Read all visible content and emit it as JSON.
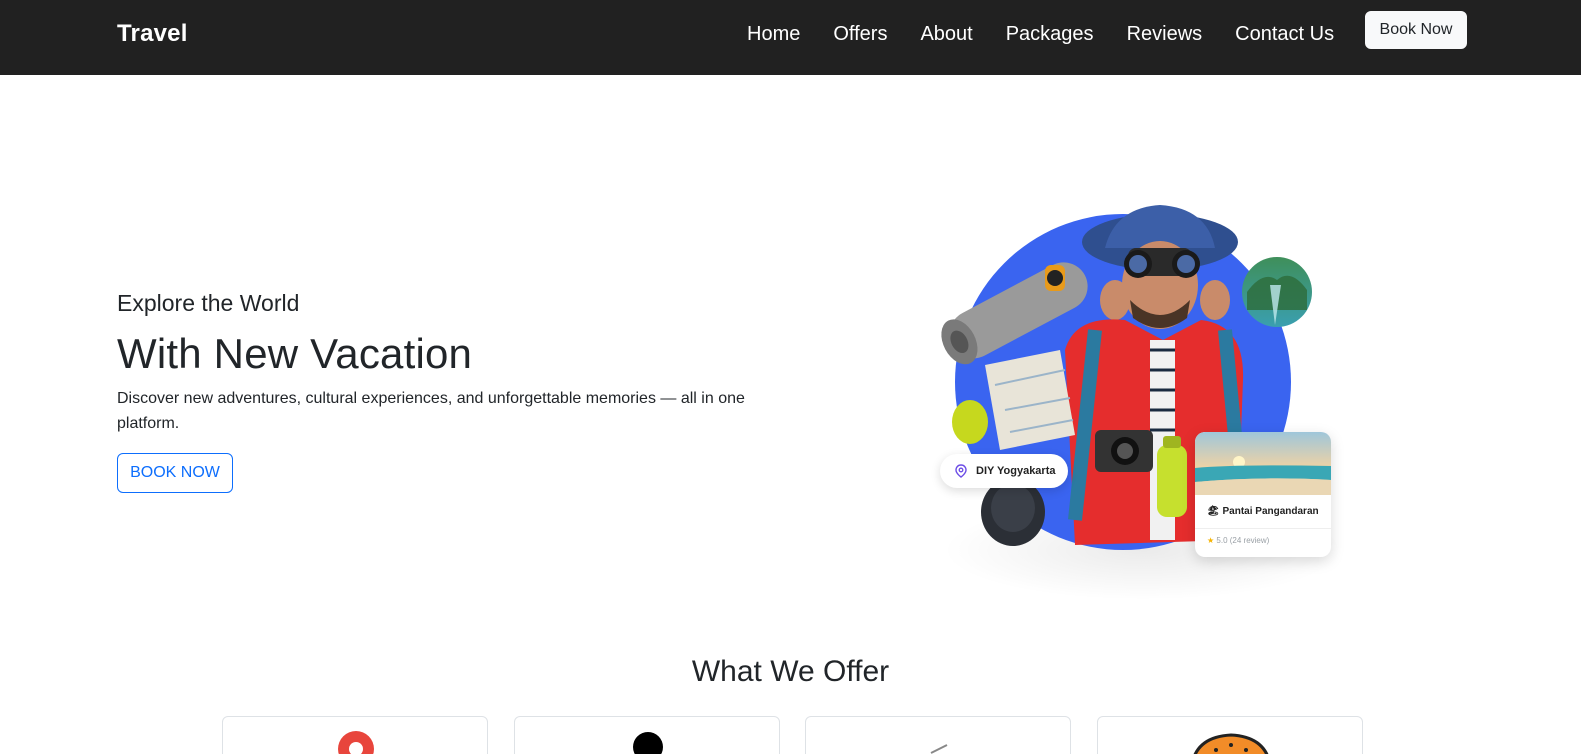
{
  "navbar": {
    "brand": "Travel",
    "links": [
      "Home",
      "Offers",
      "About",
      "Packages",
      "Reviews",
      "Contact Us"
    ],
    "cta": "Book Now"
  },
  "hero": {
    "subtitle": "Explore the World",
    "title": "With New Vacation",
    "description": "Discover new adventures, cultural experiences, and unforgettable memories — all in one platform.",
    "button": "BOOK NOW",
    "location_pill": "DIY Yogyakarta",
    "place_card": {
      "name": "Pantai Pangandaran",
      "rating": "5.0 (24 review)"
    }
  },
  "offers": {
    "title": "What We Offer",
    "cards": [
      {
        "icon": "map-pin-icon"
      },
      {
        "icon": "person-icon"
      },
      {
        "icon": "plane-icon"
      },
      {
        "icon": "burger-icon"
      }
    ]
  },
  "colors": {
    "navbar_bg": "#212121",
    "primary": "#0d6efd",
    "hero_circle": "#3a64f0",
    "jacket_red": "#e52d2d"
  }
}
